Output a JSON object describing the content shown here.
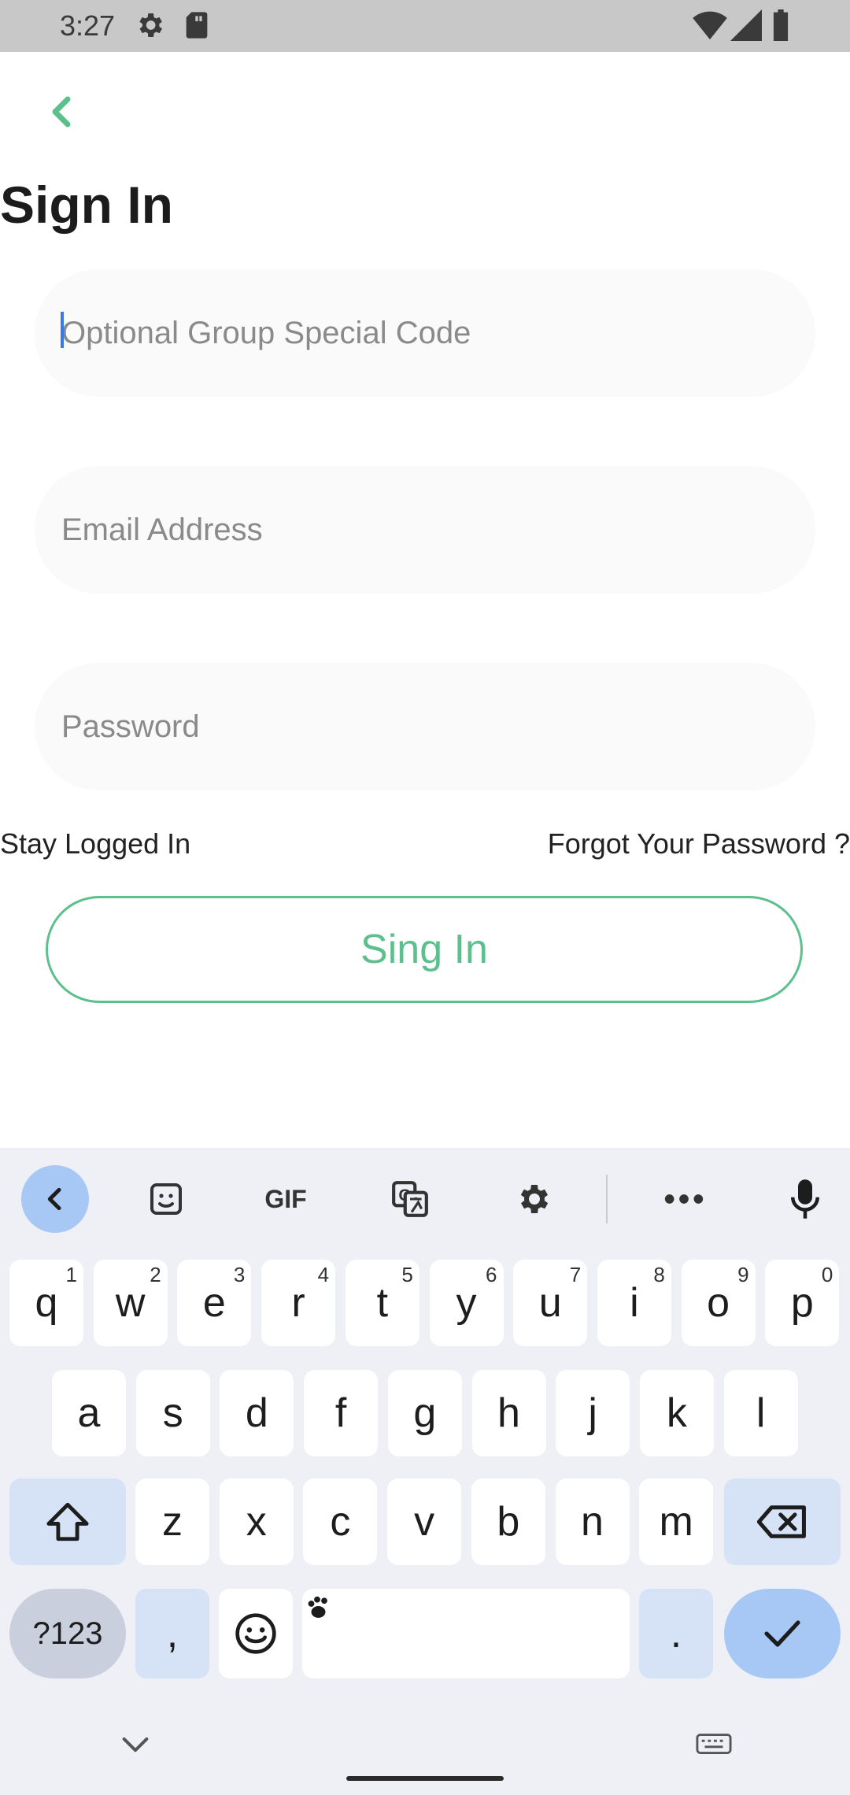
{
  "status_bar": {
    "time": "3:27",
    "icons": [
      "gear-icon",
      "sd-card-icon",
      "wifi-icon",
      "signal-icon",
      "battery-icon"
    ]
  },
  "header": {
    "back_icon": "chevron-left-icon",
    "title": "Sign In"
  },
  "form": {
    "group_code": {
      "placeholder": "Optional Group Special Code",
      "value": ""
    },
    "email": {
      "placeholder": "Email Address",
      "value": ""
    },
    "password": {
      "placeholder": "Password",
      "value": ""
    },
    "stay_logged_in_label": "Stay Logged In",
    "forgot_password_label": "Forgot Your Password ?",
    "submit_label": "Sing In"
  },
  "colors": {
    "accent": "#5cc08d",
    "field_bg": "#fafafa",
    "keyboard_bg": "#eef0f6",
    "keyboard_accent": "#a7c8f5"
  },
  "keyboard": {
    "toolbar": [
      "back-icon",
      "sticker-icon",
      "gif-icon",
      "translate-icon",
      "settings-icon",
      "more-icon",
      "mic-icon"
    ],
    "gif_label": "GIF",
    "row1": [
      {
        "k": "q",
        "n": "1"
      },
      {
        "k": "w",
        "n": "2"
      },
      {
        "k": "e",
        "n": "3"
      },
      {
        "k": "r",
        "n": "4"
      },
      {
        "k": "t",
        "n": "5"
      },
      {
        "k": "y",
        "n": "6"
      },
      {
        "k": "u",
        "n": "7"
      },
      {
        "k": "i",
        "n": "8"
      },
      {
        "k": "o",
        "n": "9"
      },
      {
        "k": "p",
        "n": "0"
      }
    ],
    "row2": [
      "a",
      "s",
      "d",
      "f",
      "g",
      "h",
      "j",
      "k",
      "l"
    ],
    "row3": [
      "z",
      "x",
      "c",
      "v",
      "b",
      "n",
      "m"
    ],
    "symbols_label": "?123",
    "comma_label": ",",
    "period_label": "."
  }
}
